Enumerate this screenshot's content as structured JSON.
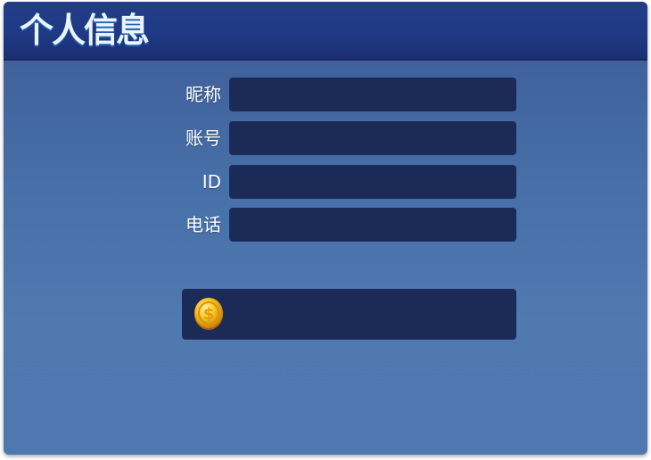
{
  "window": {
    "title": "个人信息"
  },
  "form": {
    "fields": [
      {
        "label": "昵称",
        "value": ""
      },
      {
        "label": "账号",
        "value": ""
      },
      {
        "label": "ID",
        "value": ""
      },
      {
        "label": "电话",
        "value": ""
      }
    ]
  },
  "coins": {
    "icon": "gold-coin-icon",
    "value": ""
  },
  "colors": {
    "header": "#1f3a86",
    "panel": "#4f78b0",
    "field": "#1c2a58",
    "coin": "#f2b51c"
  }
}
